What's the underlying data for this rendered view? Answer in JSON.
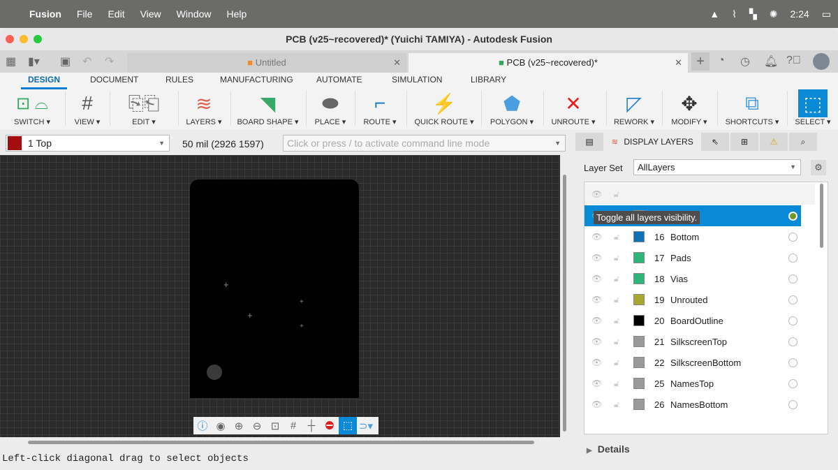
{
  "menubar": {
    "apple": "",
    "app": "Fusion",
    "items": [
      "File",
      "Edit",
      "View",
      "Window",
      "Help"
    ],
    "clock": "2:24"
  },
  "window": {
    "title": "PCB (v25~recovered)* (Yuichi TAMIYA) - Autodesk Fusion"
  },
  "tabs": [
    {
      "label": "Untitled",
      "active": false
    },
    {
      "label": "PCB (v25~recovered)*",
      "active": true
    }
  ],
  "ribbon_tabs": [
    "DESIGN",
    "DOCUMENT",
    "RULES",
    "MANUFACTURING",
    "AUTOMATE",
    "SIMULATION",
    "LIBRARY"
  ],
  "tools": [
    {
      "label": "SWITCH ▾"
    },
    {
      "label": "VIEW ▾"
    },
    {
      "label": "EDIT ▾"
    },
    {
      "label": "LAYERS ▾"
    },
    {
      "label": "BOARD SHAPE ▾"
    },
    {
      "label": "PLACE ▾"
    },
    {
      "label": "ROUTE ▾"
    },
    {
      "label": "QUICK ROUTE ▾"
    },
    {
      "label": "POLYGON ▾"
    },
    {
      "label": "UNROUTE ▾"
    },
    {
      "label": "REWORK ▾"
    },
    {
      "label": "MODIFY ▾"
    },
    {
      "label": "SHORTCUTS ▾"
    },
    {
      "label": "SELECT ▾"
    }
  ],
  "layer_select": {
    "value": "1 Top",
    "color": "#a50e0e"
  },
  "grid_readout": "50 mil (2926 1597)",
  "command_line": {
    "placeholder": "Click or press / to activate command line mode"
  },
  "panel": {
    "tab_label": "DISPLAY LAYERS",
    "layer_set_label": "Layer Set",
    "layer_set_value": "AllLayers",
    "tooltip": "Toggle all layers visibility.",
    "details": "Details"
  },
  "layers": [
    {
      "num": "1",
      "name": "Top",
      "color": "#a50e0e",
      "selected": true,
      "active": true
    },
    {
      "num": "16",
      "name": "Bottom",
      "color": "#0e72b4"
    },
    {
      "num": "17",
      "name": "Pads",
      "color": "#2fb57a"
    },
    {
      "num": "18",
      "name": "Vias",
      "color": "#2fb57a"
    },
    {
      "num": "19",
      "name": "Unrouted",
      "color": "#a8a830"
    },
    {
      "num": "20",
      "name": "BoardOutline",
      "color": "#000000"
    },
    {
      "num": "21",
      "name": "SilkscreenTop",
      "color": "#999999"
    },
    {
      "num": "22",
      "name": "SilkscreenBottom",
      "color": "#999999"
    },
    {
      "num": "25",
      "name": "NamesTop",
      "color": "#999999"
    },
    {
      "num": "26",
      "name": "NamesBottom",
      "color": "#999999"
    }
  ],
  "status": "Left-click diagonal drag to select objects"
}
